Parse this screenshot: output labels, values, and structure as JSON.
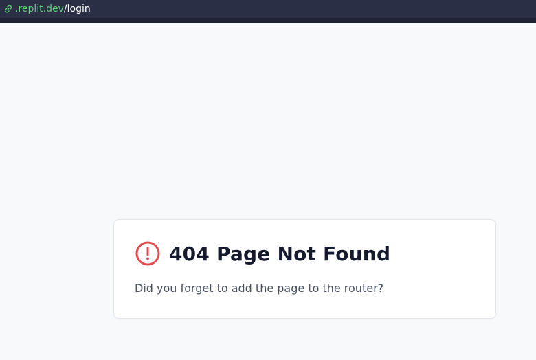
{
  "browser": {
    "url_domain": ".replit.dev",
    "url_path": "/login",
    "link_icon": "link-icon"
  },
  "error_card": {
    "icon": "alert-circle-icon",
    "title": "404 Page Not Found",
    "message": "Did you forget to add the page to the router?",
    "accent_color": "#e5484d"
  }
}
